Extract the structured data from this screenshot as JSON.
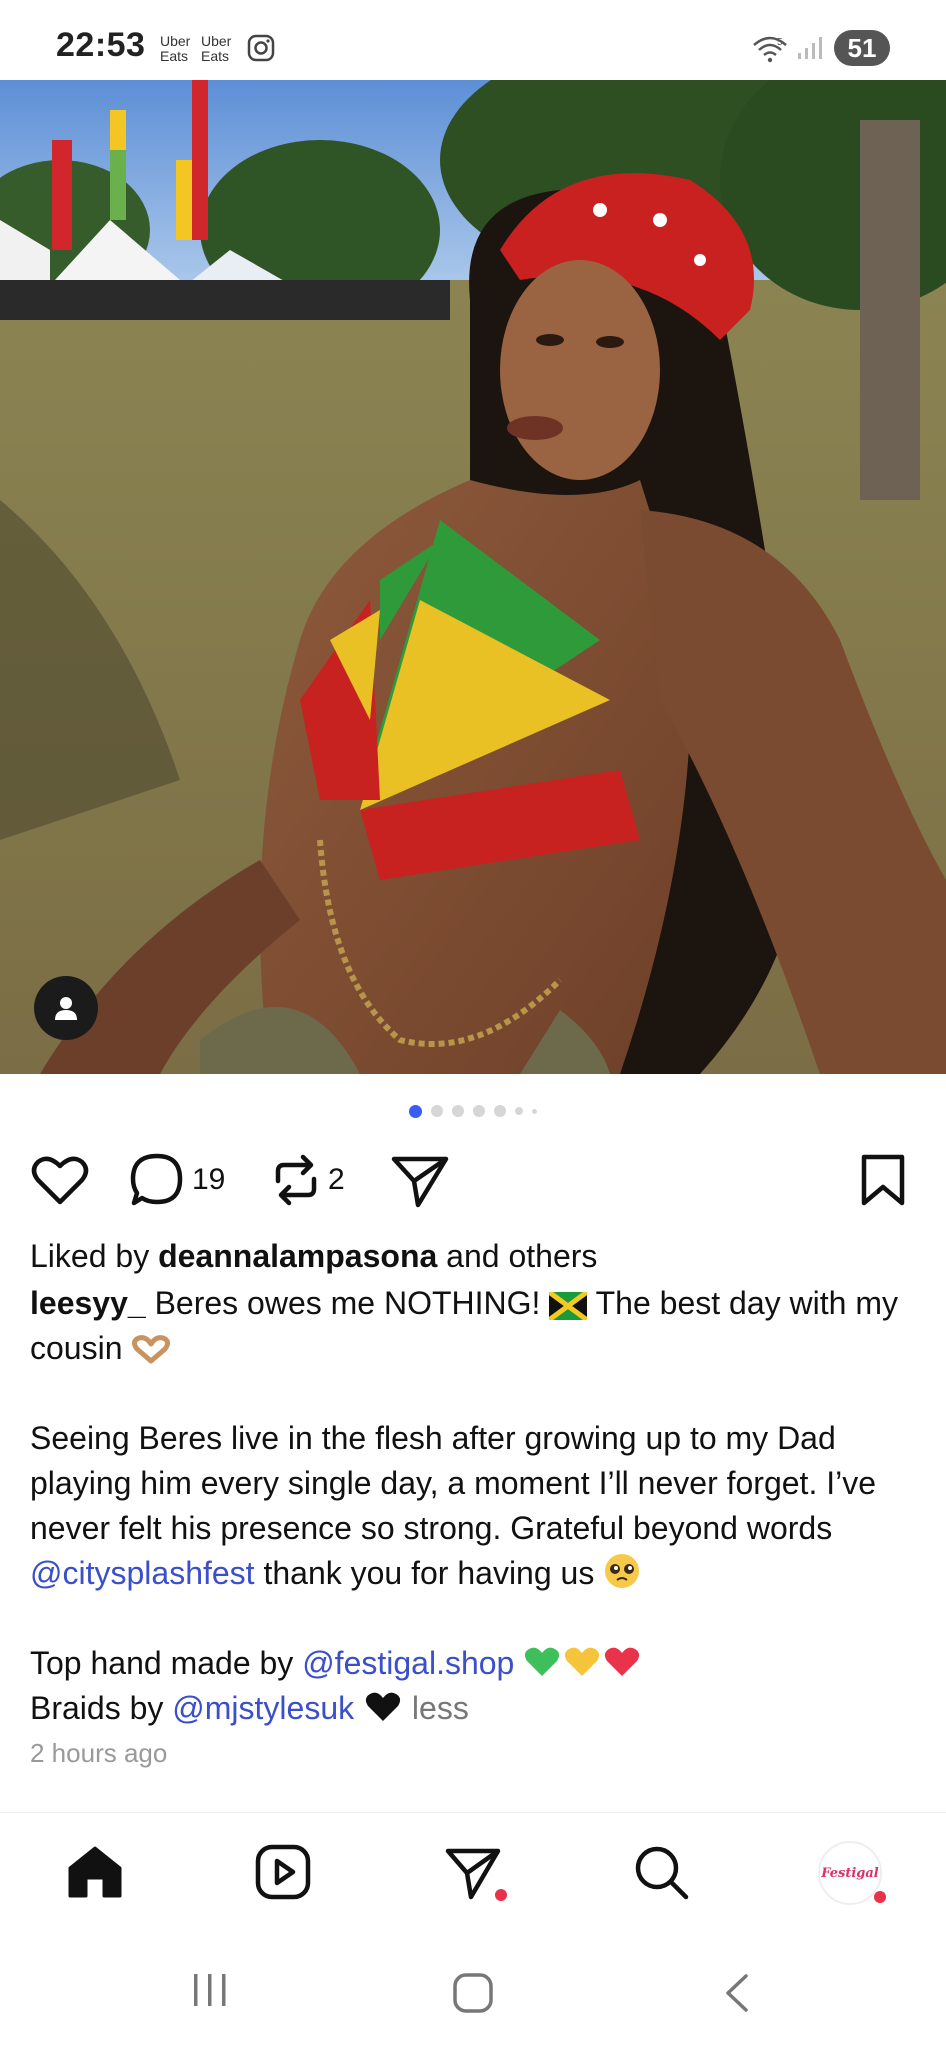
{
  "status_bar": {
    "time": "22:53",
    "notifications": [
      "Uber Eats",
      "Uber Eats"
    ],
    "notification_icons": [
      "instagram-icon"
    ],
    "wifi_label": "5",
    "battery": "51"
  },
  "post": {
    "carousel": {
      "total": 7,
      "active_index": 0
    },
    "actions": {
      "comments_count": "19",
      "reposts_count": "2"
    },
    "liked_by_prefix": "Liked by",
    "liked_by_user": "deannalampasona",
    "liked_by_suffix": "and others",
    "author": "leesyy_",
    "caption_line1": " Beres owes me NOTHING! ",
    "caption_line1b": " The best day with my cousin ",
    "caption_para2a": "Seeing Beres live in the flesh after growing up to my Dad playing him every single day, a moment I’ll never forget. I’ve never felt his presence so strong. Grateful beyond words ",
    "caption_mention1": "@citysplashfest",
    "caption_para2b": " thank you for having us ",
    "caption_line3a": "Top hand made by ",
    "caption_mention2": "@festigal.shop",
    "caption_line4a": "Braids by ",
    "caption_mention3": "@mjstylesuk",
    "less_label": "less",
    "time_ago": "2 hours ago"
  },
  "bottom_nav": {
    "items": [
      "home",
      "reels",
      "messages",
      "search",
      "profile"
    ],
    "profile_avatar_text": "Festigal"
  },
  "colors": {
    "mention": "#3a4fc9",
    "active_dot": "#3b5cf0",
    "notification_dot": "#e8324a"
  }
}
